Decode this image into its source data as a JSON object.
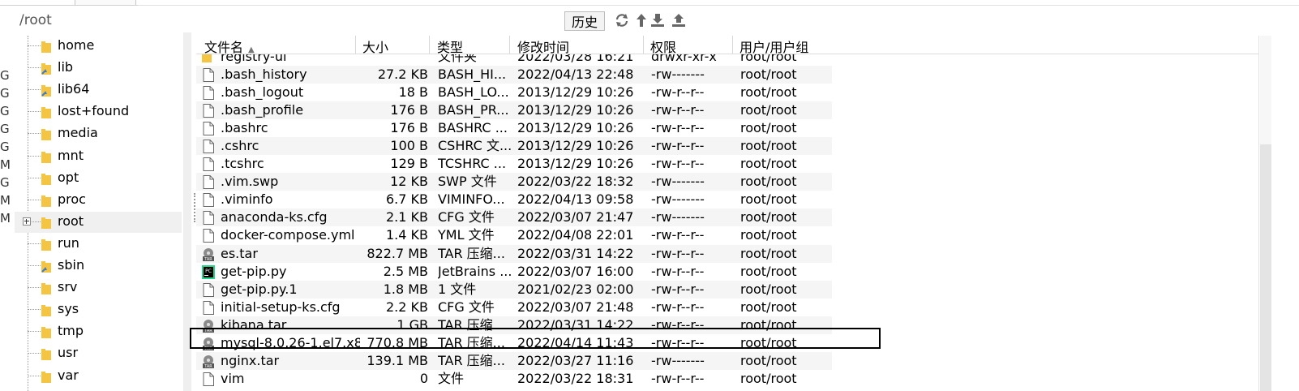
{
  "pathbar": {
    "path": "/root",
    "history_label": "历史"
  },
  "left_strip": [
    "G",
    "G",
    "G",
    "G",
    "G",
    "M",
    "G",
    "M",
    "M"
  ],
  "tree": {
    "items": [
      {
        "label": "home",
        "icon": "folder-icon"
      },
      {
        "label": "lib",
        "icon": "folder-link-icon"
      },
      {
        "label": "lib64",
        "icon": "folder-link-icon"
      },
      {
        "label": "lost+found",
        "icon": "folder-icon"
      },
      {
        "label": "media",
        "icon": "folder-icon"
      },
      {
        "label": "mnt",
        "icon": "folder-icon"
      },
      {
        "label": "opt",
        "icon": "folder-icon"
      },
      {
        "label": "proc",
        "icon": "folder-icon"
      },
      {
        "label": "root",
        "icon": "folder-icon"
      },
      {
        "label": "run",
        "icon": "folder-icon"
      },
      {
        "label": "sbin",
        "icon": "folder-link-icon"
      },
      {
        "label": "srv",
        "icon": "folder-icon"
      },
      {
        "label": "sys",
        "icon": "folder-icon"
      },
      {
        "label": "tmp",
        "icon": "folder-icon"
      },
      {
        "label": "usr",
        "icon": "folder-icon"
      },
      {
        "label": "var",
        "icon": "folder-icon"
      }
    ]
  },
  "filelist": {
    "columns": [
      "文件名",
      "大小",
      "类型",
      "修改时间",
      "权限",
      "用户/用户组"
    ],
    "partial_row": {
      "name": "registry-ui",
      "size": "",
      "type": "文件夹",
      "time": "2022/03/28 16:21",
      "perm": "drwxr-xr-x",
      "owner": "root/root"
    },
    "rows": [
      {
        "name": ".bash_history",
        "size": "27.2 KB",
        "type": "BASH_HI...",
        "time": "2022/04/13 22:48",
        "perm": "-rw-------",
        "owner": "root/root",
        "icon": "file-icon"
      },
      {
        "name": ".bash_logout",
        "size": "18 B",
        "type": "BASH_LO...",
        "time": "2013/12/29 10:26",
        "perm": "-rw-r--r--",
        "owner": "root/root",
        "icon": "file-icon"
      },
      {
        "name": ".bash_profile",
        "size": "176 B",
        "type": "BASH_PR...",
        "time": "2013/12/29 10:26",
        "perm": "-rw-r--r--",
        "owner": "root/root",
        "icon": "file-icon"
      },
      {
        "name": ".bashrc",
        "size": "176 B",
        "type": "BASHRC ...",
        "time": "2013/12/29 10:26",
        "perm": "-rw-r--r--",
        "owner": "root/root",
        "icon": "file-icon"
      },
      {
        "name": ".cshrc",
        "size": "100 B",
        "type": "CSHRC 文...",
        "time": "2013/12/29 10:26",
        "perm": "-rw-r--r--",
        "owner": "root/root",
        "icon": "file-icon"
      },
      {
        "name": ".tcshrc",
        "size": "129 B",
        "type": "TCSHRC ...",
        "time": "2013/12/29 10:26",
        "perm": "-rw-r--r--",
        "owner": "root/root",
        "icon": "file-icon"
      },
      {
        "name": ".vim.swp",
        "size": "12 KB",
        "type": "SWP 文件",
        "time": "2022/03/22 18:32",
        "perm": "-rw-------",
        "owner": "root/root",
        "icon": "file-icon"
      },
      {
        "name": ".viminfo",
        "size": "6.7 KB",
        "type": "VIMINFO...",
        "time": "2022/04/13 09:58",
        "perm": "-rw-------",
        "owner": "root/root",
        "icon": "file-icon"
      },
      {
        "name": "anaconda-ks.cfg",
        "size": "2.1 KB",
        "type": "CFG 文件",
        "time": "2022/03/07 21:47",
        "perm": "-rw-------",
        "owner": "root/root",
        "icon": "file-icon"
      },
      {
        "name": "docker-compose.yml",
        "size": "1.4 KB",
        "type": "YML 文件",
        "time": "2022/04/08 22:01",
        "perm": "-rw-r--r--",
        "owner": "root/root",
        "icon": "file-icon"
      },
      {
        "name": "es.tar",
        "size": "822.7 MB",
        "type": "TAR 压缩...",
        "time": "2022/03/31 14:22",
        "perm": "-rw-r--r--",
        "owner": "root/root",
        "icon": "tar-archive-icon"
      },
      {
        "name": "get-pip.py",
        "size": "2.5 MB",
        "type": "JetBrains ...",
        "time": "2022/03/07 16:00",
        "perm": "-rw-r--r--",
        "owner": "root/root",
        "icon": "pycharm-icon"
      },
      {
        "name": "get-pip.py.1",
        "size": "1.8 MB",
        "type": "1 文件",
        "time": "2021/02/23 02:00",
        "perm": "-rw-r--r--",
        "owner": "root/root",
        "icon": "file-icon"
      },
      {
        "name": "initial-setup-ks.cfg",
        "size": "2.2 KB",
        "type": "CFG 文件",
        "time": "2022/03/07 21:48",
        "perm": "-rw-r--r--",
        "owner": "root/root",
        "icon": "file-icon"
      },
      {
        "name": "kibana.tar",
        "size": "1 GB",
        "type": "TAR 压缩...",
        "time": "2022/03/31 14:22",
        "perm": "-rw-r--r--",
        "owner": "root/root",
        "icon": "tar-archive-icon"
      },
      {
        "name": "mysql-8.0.26-1.el7.x8...",
        "size": "770.8 MB",
        "type": "TAR 压缩...",
        "time": "2022/04/14 11:43",
        "perm": "-rw-r--r--",
        "owner": "root/root",
        "icon": "tar-archive-icon"
      },
      {
        "name": "nginx.tar",
        "size": "139.1 MB",
        "type": "TAR 压缩...",
        "time": "2022/03/27 11:16",
        "perm": "-rw-------",
        "owner": "root/root",
        "icon": "tar-archive-icon"
      },
      {
        "name": "vim",
        "size": "0",
        "type": "文件",
        "time": "2022/03/22 18:31",
        "perm": "-rw-r--r--",
        "owner": "root/root",
        "icon": "file-icon"
      }
    ]
  },
  "colors": {
    "folder": "#f4c542",
    "link_arrow": "#3a7bd5",
    "highlight": "#000000"
  }
}
